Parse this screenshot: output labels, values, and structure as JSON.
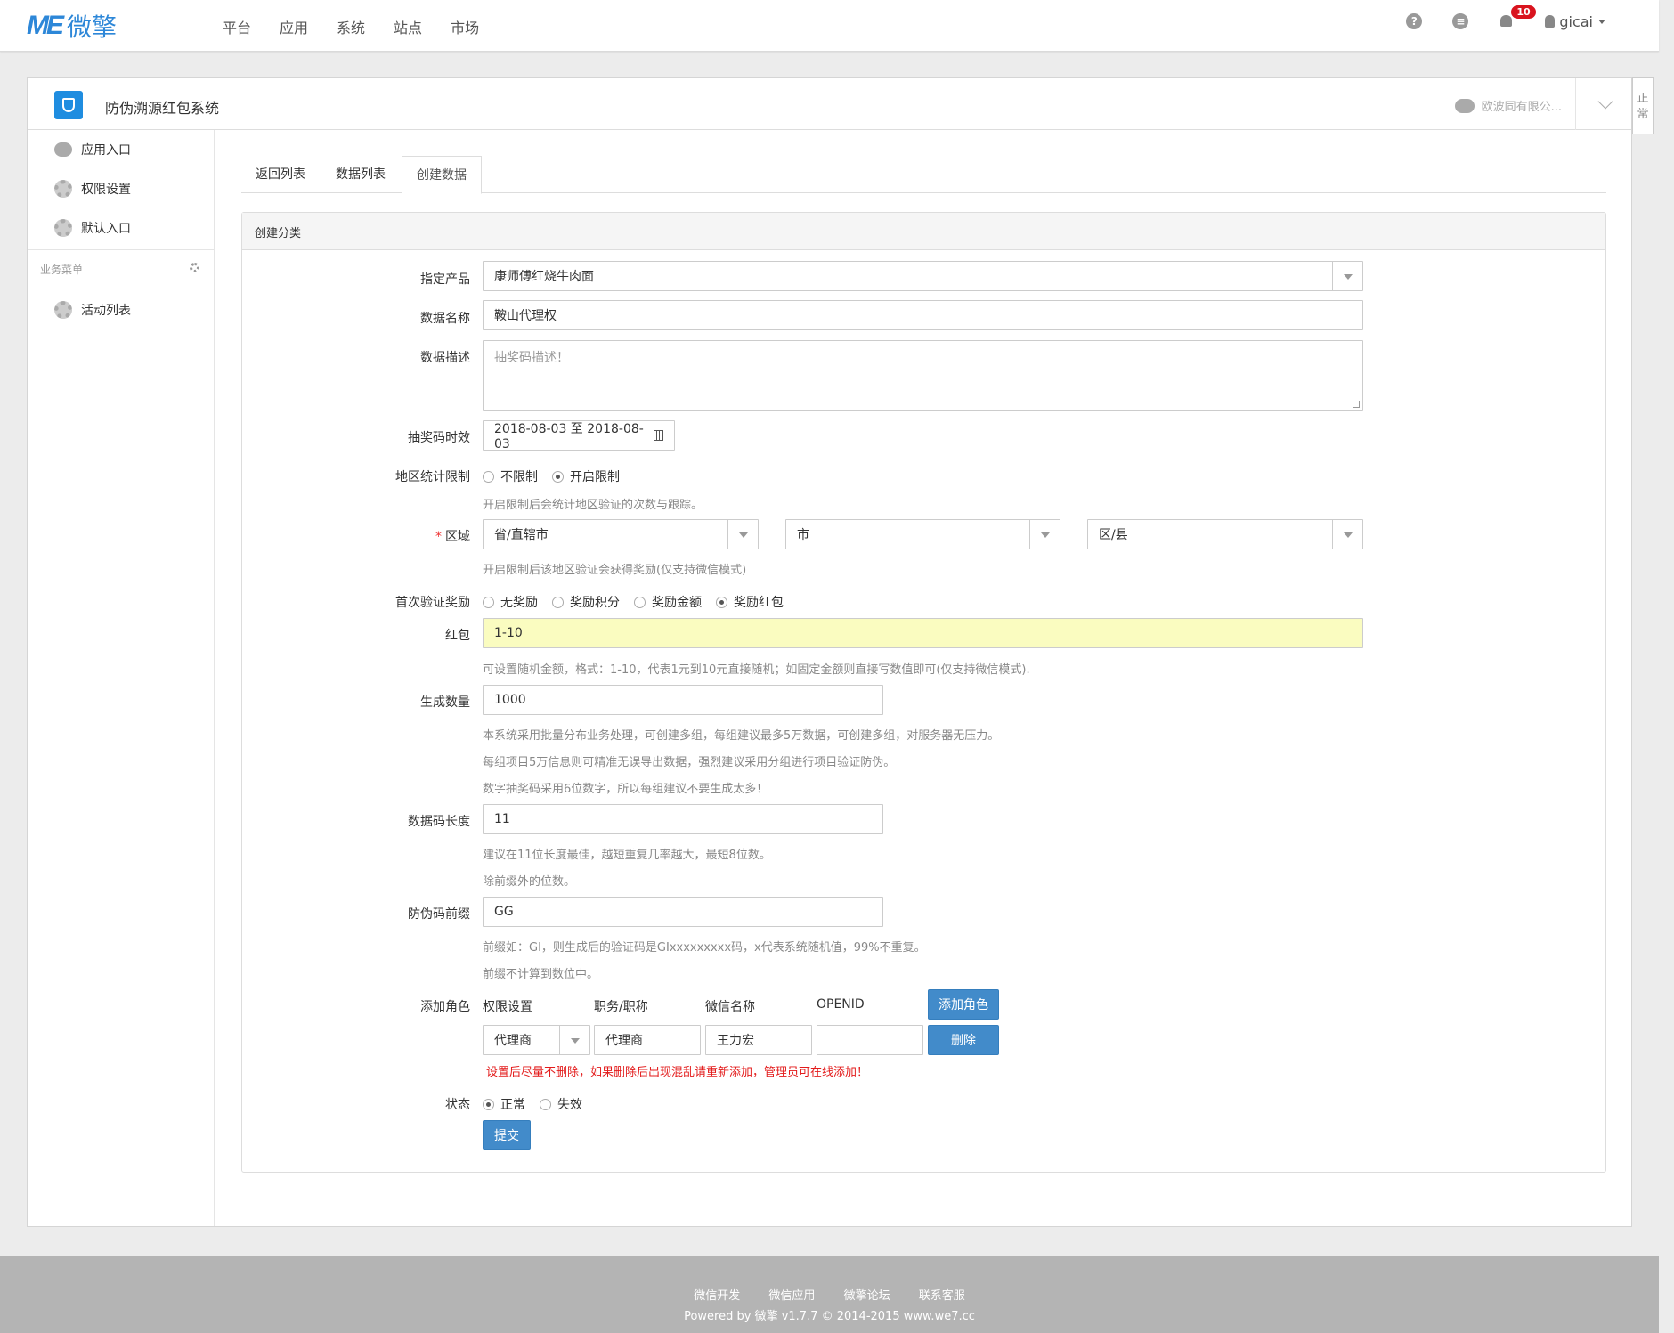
{
  "brand": {
    "logo_me": "ME",
    "logo_cn": "微擎"
  },
  "nav": [
    "平台",
    "应用",
    "系统",
    "站点",
    "市场"
  ],
  "topright": {
    "help_glyph": "?",
    "notif_count": "10",
    "username": "gicai"
  },
  "app": {
    "title": "防伪溯源红包系统",
    "account": "欧波同有限公..."
  },
  "right_tab": "正常",
  "sidebar": {
    "items": [
      {
        "label": "应用入口",
        "icon": "chat-icon"
      },
      {
        "label": "权限设置",
        "icon": "gear-icon"
      },
      {
        "label": "默认入口",
        "icon": "gear-icon"
      }
    ],
    "section": "业务菜单",
    "section_items": [
      {
        "label": "活动列表",
        "icon": "gear-icon"
      }
    ]
  },
  "tabs": [
    "返回列表",
    "数据列表",
    "创建数据"
  ],
  "panel_title": "创建分类",
  "form": {
    "product": {
      "label": "指定产品",
      "value": "康师傅红烧牛肉面"
    },
    "name": {
      "label": "数据名称",
      "value": "鞍山代理权"
    },
    "desc": {
      "label": "数据描述",
      "placeholder": "抽奖码描述！"
    },
    "validity": {
      "label": "抽奖码时效",
      "value": "2018-08-03 至 2018-08-03"
    },
    "region_limit": {
      "label": "地区统计限制",
      "options": [
        "不限制",
        "开启限制"
      ],
      "selected": 1,
      "help": "开启限制后会统计地区验证的次数与跟踪。"
    },
    "area": {
      "required": "*",
      "label": "区域",
      "province": "省/直辖市",
      "city": "市",
      "district": "区/县",
      "help": "开启限制后该地区验证会获得奖励(仅支持微信模式)"
    },
    "first_reward": {
      "label": "首次验证奖励",
      "options": [
        "无奖励",
        "奖励积分",
        "奖励金额",
        "奖励红包"
      ],
      "selected": 3
    },
    "redpack": {
      "label": "红包",
      "value": "1-10",
      "help": "可设置随机金额，格式：1-10，代表1元到10元直接随机；如固定金额则直接写数值即可(仅支持微信模式)."
    },
    "quantity": {
      "label": "生成数量",
      "value": "1000",
      "help": [
        "本系统采用批量分布业务处理，可创建多组，每组建议最多5万数据，可创建多组，对服务器无压力。",
        "每组项目5万信息则可精准无误导出数据，强烈建议采用分组进行项目验证防伪。",
        "数字抽奖码采用6位数字，所以每组建议不要生成太多！"
      ]
    },
    "code_length": {
      "label": "数据码长度",
      "value": "11",
      "help": [
        "建议在11位长度最佳，越短重复几率越大，最短8位数。",
        "除前缀外的位数。"
      ]
    },
    "prefix": {
      "label": "防伪码前缀",
      "value": "GG",
      "help": [
        "前缀如：GI，则生成后的验证码是GIxxxxxxxxx码，x代表系统随机值，99%不重复。",
        "前缀不计算到数位中。"
      ]
    },
    "roles": {
      "label": "添加角色",
      "headers": [
        "权限设置",
        "职务/职称",
        "微信名称",
        "OPENID"
      ],
      "add_button": "添加角色",
      "row": {
        "permission": "代理商",
        "title": "代理商",
        "wechat": "王力宏",
        "openid": ""
      },
      "delete_button": "删除",
      "warning": "设置后尽量不删除，如果删除后出现混乱请重新添加，管理员可在线添加！"
    },
    "status": {
      "label": "状态",
      "options": [
        "正常",
        "失效"
      ],
      "selected": 0
    },
    "submit": "提交"
  },
  "footer": {
    "links": [
      "微信开发",
      "微信应用",
      "微擎论坛",
      "联系客服"
    ],
    "copyright": "Powered by 微擎 v1.7.7 © 2014-2015 www.we7.cc"
  },
  "colors": {
    "accent": "#428bca",
    "brand": "#2d87d8",
    "highlight": "#fafcc0",
    "warning": "#e31b1b"
  }
}
